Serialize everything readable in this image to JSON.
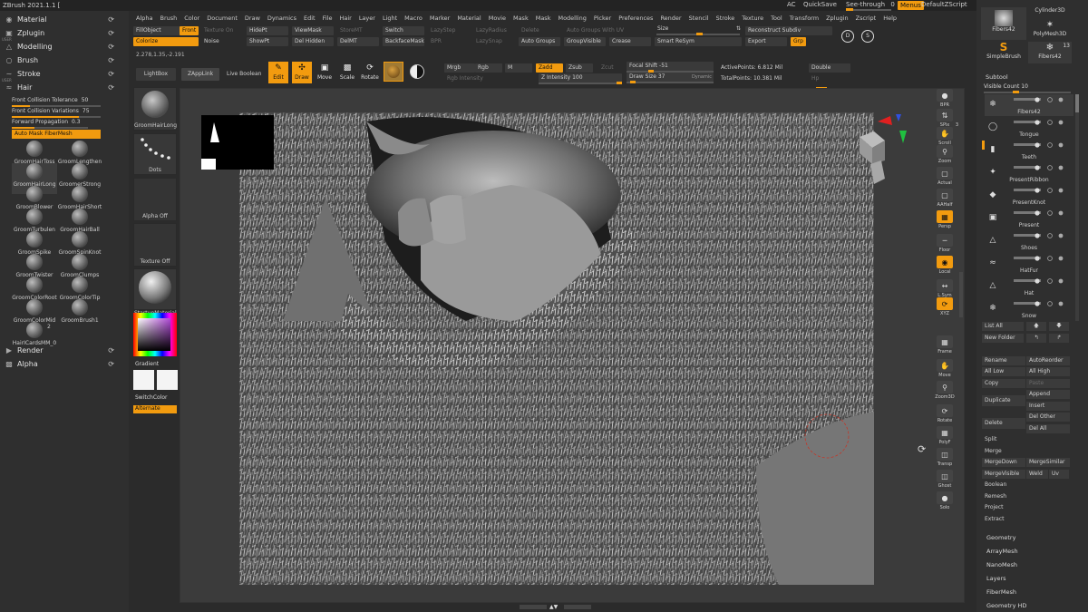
{
  "app": {
    "title": "ZBrush 2021.1.1 ["
  },
  "menubar": [
    "Alpha",
    "Brush",
    "Color",
    "Document",
    "Draw",
    "Dynamics",
    "Edit",
    "File",
    "Hair",
    "Layer",
    "Light",
    "Macro",
    "Marker",
    "Material",
    "Movie",
    "Mask",
    "Mask",
    "Modelling",
    "Picker",
    "Preferences",
    "Render",
    "Stencil",
    "Stroke",
    "Texture",
    "Tool",
    "Transform",
    "Zplugin",
    "Zscript",
    "Help"
  ],
  "topright": {
    "ac": "AC",
    "quicksave": "QuickSave",
    "seethrough": "See-through",
    "seethrough_value": "0",
    "menus": "Menus",
    "script": "DefaultZScript"
  },
  "leftTray": {
    "items": [
      {
        "label": "Material",
        "id": "material"
      },
      {
        "label": "Zplugin",
        "id": "zplugin"
      },
      {
        "label": "Modelling",
        "id": "modelling",
        "user": "USER"
      },
      {
        "label": "Brush",
        "id": "brush"
      },
      {
        "label": "Stroke",
        "id": "stroke"
      },
      {
        "label": "Hair",
        "id": "hair",
        "user": "USER"
      }
    ],
    "hairParams": [
      {
        "label": "Front Collision Tolerance",
        "value": "50",
        "fill": 0.2
      },
      {
        "label": "Front Collision Variations",
        "value": "75",
        "fill": 0.75
      },
      {
        "label": "Forward Propagation",
        "value": "0.3",
        "fill": 0.3
      }
    ],
    "autoMask": "Auto Mask FiberMesh",
    "brushes": [
      "GroomHairToss",
      "GroomLengthen",
      "GroomHairLong",
      "GroomerStrong",
      "GroomBlower",
      "GroomHairShort",
      "GroomTurbulen",
      "GroomHairBall",
      "GroomSpike",
      "GroomSpinKnot",
      "GroomTwister",
      "GroomClumps",
      "GroomColorRoot",
      "GroomColorTip",
      "GroomColorMid",
      "GroomBrush1",
      "HairICardsMM_0"
    ],
    "hairCardsCount": "2",
    "render": "Render",
    "alpha": "Alpha"
  },
  "toolcol": {
    "brushName": "GroomHairLong",
    "dots": "Dots",
    "alphaOff": "Alpha Off",
    "textureOff": "Texture Off",
    "material": "StartupMaterial",
    "gradient": "Gradient",
    "switchColor": "SwitchColor",
    "alternate": "Alternate",
    "lightbox": "LightBox",
    "zapplink": "ZAppLink",
    "liveBoolean": "Live Boolean"
  },
  "strip1": {
    "fillobject": "FillObject",
    "front": "Front",
    "textureOn": "Texture On",
    "hidept": "HidePt",
    "viewmask": "ViewMask",
    "switch": "Switch",
    "lazystep": "LazyStep",
    "lazyradius": "LazyRadius",
    "delete": "Delete",
    "autogroupsuv": "Auto Groups With UV",
    "size": "Size",
    "reconstruct": "Reconstruct Subdiv",
    "colorize": "Colorize",
    "noise": "Noise",
    "showpt": "ShowPt",
    "delhidden": "Del Hidden",
    "storemt": "StoreMT",
    "delmt": "DelMT",
    "backfacemask": "BackfaceMask",
    "bpr": "BPR",
    "lazysnap": "LazySnap",
    "autogroups": "Auto Groups",
    "groupvisible": "GroupVisible",
    "crease": "Crease",
    "smartresym": "Smart ReSym",
    "export": "Export",
    "grp": "Grp",
    "coords": "2.278,1.35,-2.191"
  },
  "strip2": {
    "edit": "Edit",
    "draw": "Draw",
    "move": "Move",
    "scale": "Scale",
    "rotate": "Rotate",
    "mrgb": "Mrgb",
    "rgb": "Rgb",
    "m": "M",
    "rgbIntensity": "Rgb Intensity",
    "zadd": "Zadd",
    "zsub": "Zsub",
    "zcut": "Zcut",
    "zIntensity": "Z Intensity",
    "zIntensityValue": "100",
    "focalShift": "Focal Shift",
    "focalShiftValue": "-51",
    "drawSize": "Draw Size",
    "drawSizeValue": "37",
    "dynamic": "Dynamic",
    "activePoints": "ActivePoints:",
    "activePointsValue": "6.812 Mil",
    "totalPoints": "TotalPoints:",
    "totalPointsValue": "10.381 Mil",
    "double": "Double",
    "hp": "Hp"
  },
  "rightShelf": [
    "BPR",
    "SPix",
    "Scroll",
    "Zoom",
    "Actual",
    "AAHalf",
    "Persp",
    "Floor",
    "Local",
    "L.Sym",
    "XYZ",
    "Frame",
    "Move",
    "Zoom3D",
    "Rotate",
    "PolyF",
    "Transp",
    "Ghost",
    "Solo"
  ],
  "rightShelfSpix": "3",
  "rightTray": {
    "tools": [
      {
        "label": "Fibers42"
      },
      {
        "label": "Cylinder3D"
      },
      {
        "label": "PolyMesh3D"
      },
      {
        "label": "SimpleBrush"
      },
      {
        "label": "Fibers42",
        "count": "13"
      }
    ],
    "subtoolHeader": "Subtool",
    "visibleCount": "Visible Count",
    "visibleCountValue": "10",
    "subtools": [
      "Fibers42",
      "Tongue",
      "Teeth",
      "PresentRibbon",
      "PresentKnot",
      "Present",
      "Shoes",
      "HatFur",
      "Hat",
      "Snow"
    ],
    "listAll": "List All",
    "newFolder": "New Folder",
    "buttons": [
      "Rename",
      "AutoReorder",
      "All Low",
      "All High",
      "Copy",
      "Paste",
      "Duplicate",
      "Append",
      "Insert",
      "Delete",
      "Del Other",
      "Del All",
      "Split",
      "Merge",
      "MergeDown",
      "MergeSimilar",
      "MergeVisible",
      "Weld",
      "Uv",
      "Boolean",
      "Remesh",
      "Project",
      "Extract"
    ],
    "sections": [
      "Geometry",
      "ArrayMesh",
      "NanoMesh",
      "Layers",
      "FiberMesh",
      "Geometry HD"
    ]
  }
}
